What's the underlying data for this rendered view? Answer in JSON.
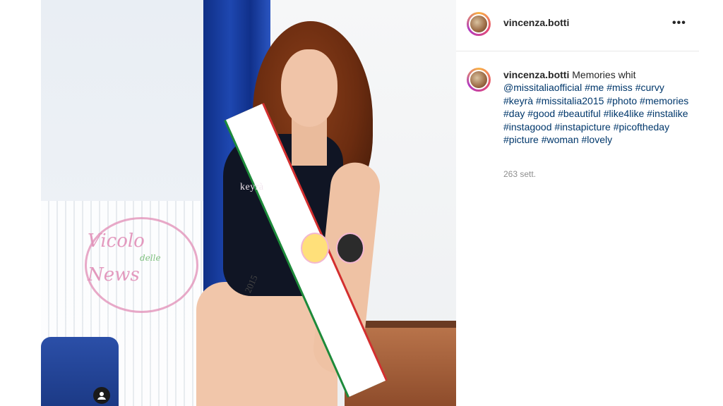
{
  "post": {
    "username": "vincenza.botti",
    "more_label": "•••",
    "caption": {
      "username": "vincenza.botti",
      "intro": "Memories whit",
      "mentions_and_tags": [
        "@missitaliaofficial",
        "#me",
        "#miss",
        "#curvy",
        "#keyrà",
        "#missitalia2015",
        "#photo",
        "#memories",
        "#day",
        "#good",
        "#beautiful",
        "#like4like",
        "#instalike",
        "#instagood",
        "#instapicture",
        "#picoftheday",
        "#picture",
        "#woman",
        "#lovely"
      ]
    },
    "timestamp": "263 sett."
  },
  "photo": {
    "brand_text": "keyrà",
    "sash_text": "2015",
    "watermark": {
      "line1": "Vicolo",
      "line2": "delle",
      "line3": "News"
    }
  },
  "colors": {
    "link": "#00376b",
    "text": "#262626",
    "muted": "#8e8e8e",
    "divider": "#e8e8e8"
  },
  "icons": {
    "profile": "user-circle-icon",
    "more": "more-horizontal-icon"
  }
}
